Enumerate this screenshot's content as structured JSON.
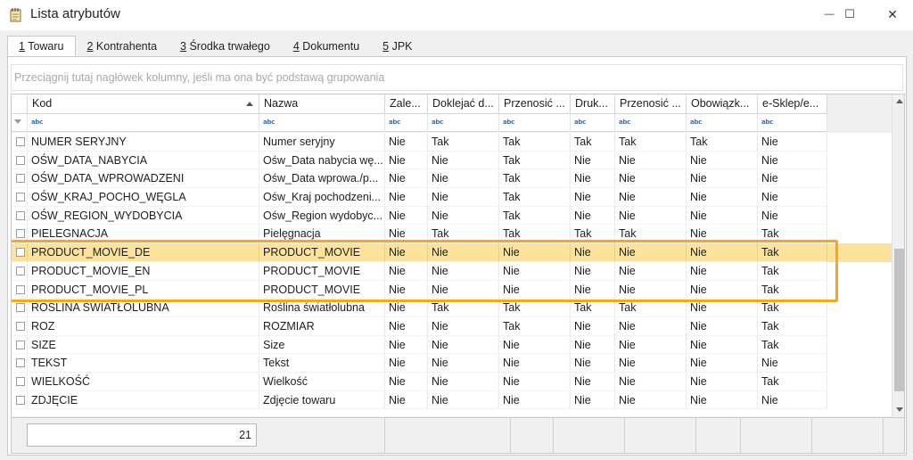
{
  "window": {
    "title": "Lista atrybutów",
    "minimize": "—",
    "maximize": "☐",
    "close": "✕"
  },
  "tabs": [
    {
      "key": "1",
      "label": " Towaru"
    },
    {
      "key": "2",
      "label": " Kontrahenta"
    },
    {
      "key": "3",
      "label": " Środka trwałego"
    },
    {
      "key": "4",
      "label": " Dokumentu"
    },
    {
      "key": "5",
      "label": " JPK"
    }
  ],
  "group_panel": {
    "placeholder": "Przeciągnij tutaj nagłówek kolumny, jeśli ma ona być podstawą grupowania"
  },
  "grid": {
    "columns": [
      "Kod",
      "Nazwa",
      "Zale...",
      "Doklejać d...",
      "Przenosić ...",
      "Druk...",
      "Przenosić ...",
      "Obowiązk...",
      "e-Sklep/e..."
    ],
    "filter_icon": "abc",
    "rows": [
      {
        "kod": "NUMER SERYJNY",
        "nazwa": "Numer seryjny",
        "v": [
          "Nie",
          "Tak",
          "Tak",
          "Tak",
          "Tak",
          "Tak",
          "Nie"
        ]
      },
      {
        "kod": "OŚW_DATA_NABYCIA",
        "nazwa": "Ośw_Data nabycia wę...",
        "v": [
          "Nie",
          "Nie",
          "Tak",
          "Nie",
          "Nie",
          "Nie",
          "Nie"
        ]
      },
      {
        "kod": "OŚW_DATA_WPROWADZENI",
        "nazwa": "Ośw_Data wprowa./p...",
        "v": [
          "Nie",
          "Nie",
          "Tak",
          "Nie",
          "Nie",
          "Nie",
          "Nie"
        ]
      },
      {
        "kod": "OŚW_KRAJ_POCHO_WĘGLA",
        "nazwa": "Ośw_Kraj pochodzeni...",
        "v": [
          "Nie",
          "Nie",
          "Tak",
          "Nie",
          "Nie",
          "Nie",
          "Nie"
        ]
      },
      {
        "kod": "OŚW_REGION_WYDOBYCIA",
        "nazwa": "Ośw_Region wydobyc...",
        "v": [
          "Nie",
          "Nie",
          "Tak",
          "Nie",
          "Nie",
          "Nie",
          "Nie"
        ]
      },
      {
        "kod": "PIELEGNACJA",
        "nazwa": "Pielęgnacja",
        "v": [
          "Nie",
          "Tak",
          "Tak",
          "Tak",
          "Tak",
          "Nie",
          "Tak"
        ]
      },
      {
        "kod": "PRODUCT_MOVIE_DE",
        "nazwa": "PRODUCT_MOVIE",
        "v": [
          "Nie",
          "Nie",
          "Nie",
          "Nie",
          "Nie",
          "Nie",
          "Tak"
        ],
        "selected": true
      },
      {
        "kod": "PRODUCT_MOVIE_EN",
        "nazwa": "PRODUCT_MOVIE",
        "v": [
          "Nie",
          "Nie",
          "Nie",
          "Nie",
          "Nie",
          "Nie",
          "Tak"
        ]
      },
      {
        "kod": "PRODUCT_MOVIE_PL",
        "nazwa": "PRODUCT_MOVIE",
        "v": [
          "Nie",
          "Nie",
          "Nie",
          "Nie",
          "Nie",
          "Nie",
          "Tak"
        ]
      },
      {
        "kod": "ROŚLINA ŚWIATŁOLUBNA",
        "nazwa": "Roślina światłolubna",
        "v": [
          "Nie",
          "Tak",
          "Tak",
          "Tak",
          "Tak",
          "Nie",
          "Tak"
        ]
      },
      {
        "kod": "ROZ",
        "nazwa": "ROZMIAR",
        "v": [
          "Nie",
          "Nie",
          "Tak",
          "Nie",
          "Nie",
          "Nie",
          "Tak"
        ]
      },
      {
        "kod": "SIZE",
        "nazwa": "Size",
        "v": [
          "Nie",
          "Nie",
          "Nie",
          "Nie",
          "Nie",
          "Nie",
          "Tak"
        ]
      },
      {
        "kod": "TEKST",
        "nazwa": "Tekst",
        "v": [
          "Nie",
          "Nie",
          "Nie",
          "Nie",
          "Nie",
          "Nie",
          "Nie"
        ]
      },
      {
        "kod": "WIELKOŚĆ",
        "nazwa": "Wielkość",
        "v": [
          "Nie",
          "Nie",
          "Nie",
          "Nie",
          "Nie",
          "Nie",
          "Tak"
        ]
      },
      {
        "kod": "ZDJĘCIE",
        "nazwa": "Zdjęcie towaru",
        "v": [
          "Nie",
          "Nie",
          "Nie",
          "Nie",
          "Nie",
          "Nie",
          "Nie"
        ]
      }
    ]
  },
  "footer": {
    "count": "21"
  },
  "colors": {
    "selected_row": "#fbe39c",
    "highlight_border": "#f5a623"
  }
}
